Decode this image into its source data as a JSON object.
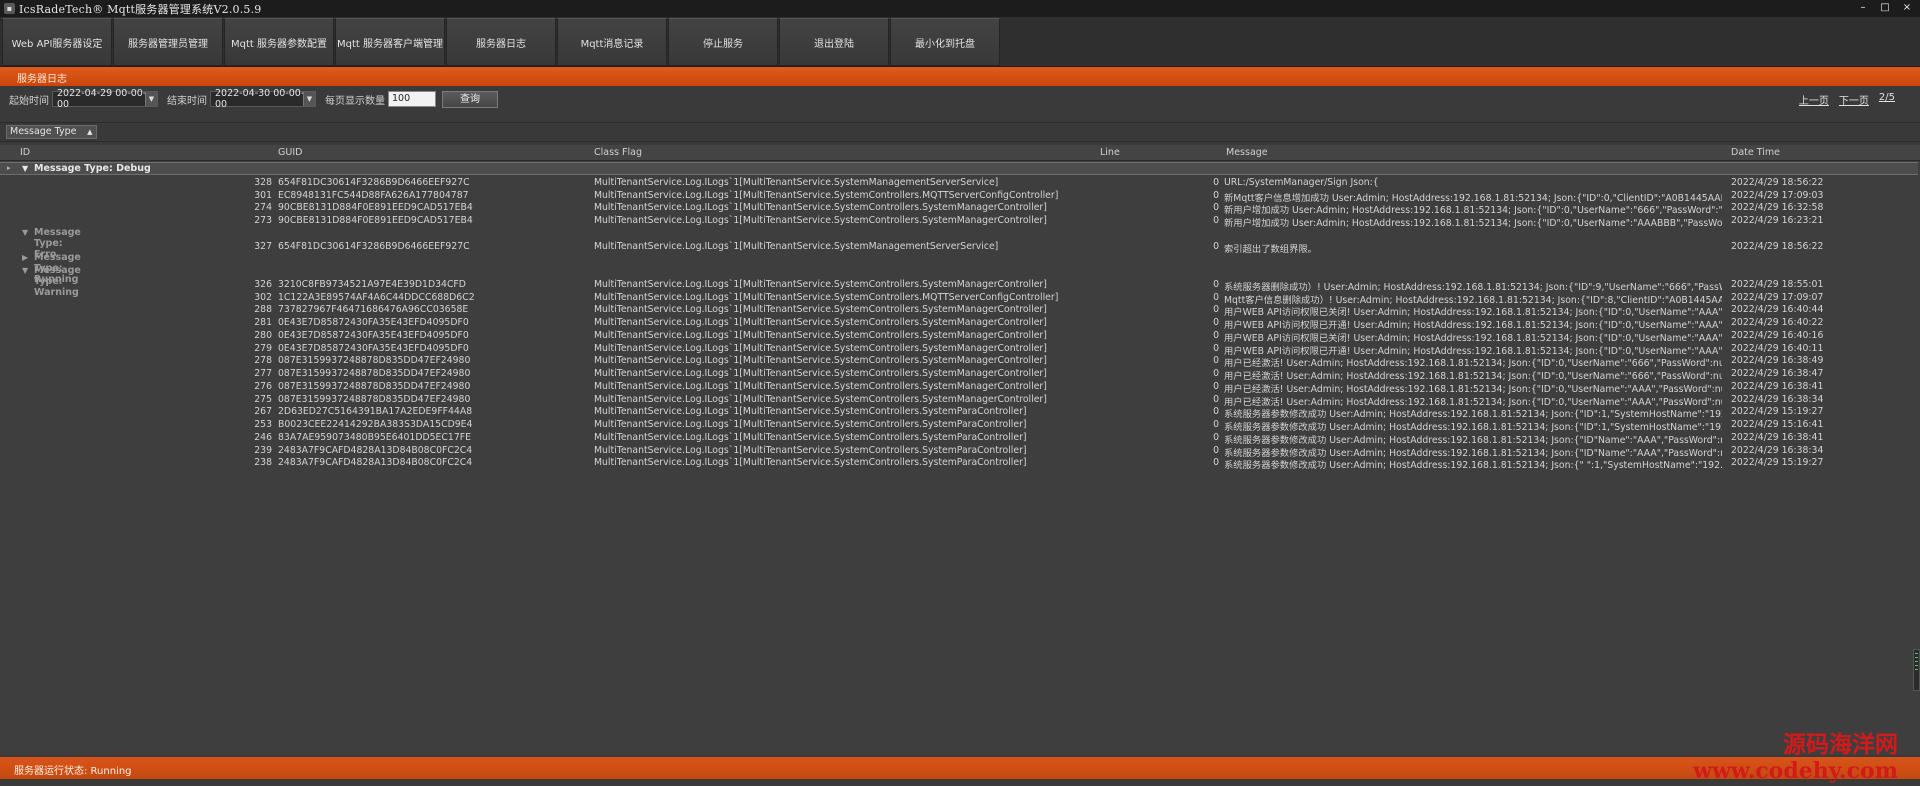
{
  "window": {
    "title": "IcsRadeTech® Mqtt服务器管理系统V2.0.5.9",
    "controls": [
      "–",
      "□",
      "×"
    ]
  },
  "menu": [
    "Web API服务器设定",
    "服务器管理员管理",
    "Mqtt 服务器参数配置",
    "Mqtt 服务器客户端管理",
    "服务器日志",
    "Mqtt消息记录",
    "停止服务",
    "退出登陆",
    "最小化到托盘"
  ],
  "section_title": "服务器日志",
  "filter": {
    "start_label": "起始时间",
    "start_value": "2022-04-29 00-00-00",
    "end_label": "结束时间",
    "end_value": "2022-04-30 00-00-00",
    "count_label": "每页显示数量",
    "count_value": "100",
    "query_button": "查询"
  },
  "pager": {
    "prev": "上一页",
    "next": "下一页",
    "page": "2/5"
  },
  "group_chip": "Message Type",
  "columns": {
    "id": "ID",
    "guid": "GUID",
    "class_flag": "Class Flag",
    "line": "Line",
    "message": "Message",
    "date_time": "Date Time"
  },
  "groups": [
    {
      "label": "Message Type: Debug",
      "rows": [
        {
          "id": "328",
          "guid": "654F81DC30614F3286B9D6466EEF927C",
          "class": "MultiTenantService.Log.ILogs`1[MultiTenantService.SystemManagementServerService]",
          "line": "0",
          "message": "URL:/SystemManager/Sign Json:{",
          "date": "2022/4/29 18:56:22"
        },
        {
          "id": "301",
          "guid": "EC8948131FC544D88FA626A177804787",
          "class": "MultiTenantService.Log.ILogs`1[MultiTenantService.SystemControllers.MQTTServerConfigController]",
          "line": "0",
          "message": "新Mqtt客户信息增加成功 User:Admin;  HostAddress:192.168.1.81:52134;  Json:{\"ID\":0,\"ClientID\":\"A0B1445AADD\",\"Us...",
          "date": "2022/4/29 17:09:03"
        },
        {
          "id": "274",
          "guid": "90CBE8131D884F0E891EED9CAD517EB4",
          "class": "MultiTenantService.Log.ILogs`1[MultiTenantService.SystemControllers.SystemManagerController]",
          "line": "0",
          "message": "新用户增加成功 User:Admin;  HostAddress:192.168.1.81:52134;  Json:{\"ID\":0,\"UserName\":\"666\",\"PassWord\":\"\",\"Key\"...",
          "date": "2022/4/29 16:32:58"
        },
        {
          "id": "273",
          "guid": "90CBE8131D884F0E891EED9CAD517EB4",
          "class": "MultiTenantService.Log.ILogs`1[MultiTenantService.SystemControllers.SystemManagerController]",
          "line": "0",
          "message": "新用户增加成功 User:Admin;  HostAddress:192.168.1.81:52134;  Json:{\"ID\":0,\"UserName\":\"AAABBB\",\"PassWord\":\"123...",
          "date": "2022/4/29 16:23:21"
        }
      ]
    },
    {
      "label": "Message Type: Erro",
      "rows": [
        {
          "id": "327",
          "guid": "654F81DC30614F3286B9D6466EEF927C",
          "class": "MultiTenantService.Log.ILogs`1[MultiTenantService.SystemManagementServerService]",
          "line": "0",
          "message": "索引超出了数组界限。",
          "date": "2022/4/29 18:56:22"
        }
      ]
    },
    {
      "label": "Message Type: Running",
      "rows": []
    },
    {
      "label": "Message Type: Warning",
      "rows": [
        {
          "id": "326",
          "guid": "3210C8FB9734521A97E4E39D1D34CFD",
          "class": "MultiTenantService.Log.ILogs`1[MultiTenantService.SystemControllers.SystemManagerController]",
          "line": "0",
          "message": "系统服务器删除成功）!  User:Admin;  HostAddress:192.168.1.81:52134;  Json:{\"ID\":9,\"UserName\":\"666\",\"PassWord\":n...",
          "date": "2022/4/29 18:55:01"
        },
        {
          "id": "302",
          "guid": "1C122A3E89574AF4A6C44DDCC688D6C2",
          "class": "MultiTenantService.Log.ILogs`1[MultiTenantService.SystemControllers.MQTTServerConfigController]",
          "line": "0",
          "message": "Mqtt客户信息删除成功）!  User:Admin;  HostAddress:192.168.1.81:52134;  Json:{\"ID\":8,\"ClientID\":\"A0B1445AADD\",\"U...",
          "date": "2022/4/29 17:09:07"
        },
        {
          "id": "288",
          "guid": "737827967F46471686476A96CC03658E",
          "class": "MultiTenantService.Log.ILogs`1[MultiTenantService.SystemControllers.SystemManagerController]",
          "line": "0",
          "message": "用户WEB API访问权限已关闭!  User:Admin;  HostAddress:192.168.1.81:52134;  Json:{\"ID\":0,\"UserName\":\"AAA\",\"Pass...",
          "date": "2022/4/29 16:40:44"
        },
        {
          "id": "281",
          "guid": "0E43E7D85872430FA35E43EFD4095DF0",
          "class": "MultiTenantService.Log.ILogs`1[MultiTenantService.SystemControllers.SystemManagerController]",
          "line": "0",
          "message": "用户WEB API访问权限已开通!  User:Admin;  HostAddress:192.168.1.81:52134;  Json:{\"ID\":0,\"UserName\":\"AAA\",\"Pass...",
          "date": "2022/4/29 16:40:22"
        },
        {
          "id": "280",
          "guid": "0E43E7D85872430FA35E43EFD4095DF0",
          "class": "MultiTenantService.Log.ILogs`1[MultiTenantService.SystemControllers.SystemManagerController]",
          "line": "0",
          "message": "用户WEB API访问权限已关闭!  User:Admin;  HostAddress:192.168.1.81:52134;  Json:{\"ID\":0,\"UserName\":\"AAA\",\"Pass...",
          "date": "2022/4/29 16:40:16"
        },
        {
          "id": "279",
          "guid": "0E43E7D85872430FA35E43EFD4095DF0",
          "class": "MultiTenantService.Log.ILogs`1[MultiTenantService.SystemControllers.SystemManagerController]",
          "line": "0",
          "message": "用户WEB API访问权限已开通!  User:Admin;  HostAddress:192.168.1.81:52134;  Json:{\"ID\":0,\"UserName\":\"AAA\",\"Pass...",
          "date": "2022/4/29 16:40:11"
        },
        {
          "id": "278",
          "guid": "087E3159937248878D835DD47EF24980",
          "class": "MultiTenantService.Log.ILogs`1[MultiTenantService.SystemControllers.SystemManagerController]",
          "line": "0",
          "message": "用户已经激活!  User:Admin;  HostAddress:192.168.1.81:52134;  Json:{\"ID\":0,\"UserName\":\"666\",\"PassWord\":null,\"Key\"...",
          "date": "2022/4/29 16:38:49"
        },
        {
          "id": "277",
          "guid": "087E3159937248878D835DD47EF24980",
          "class": "MultiTenantService.Log.ILogs`1[MultiTenantService.SystemControllers.SystemManagerController]",
          "line": "0",
          "message": "用户已经激活!  User:Admin;  HostAddress:192.168.1.81:52134;  Json:{\"ID\":0,\"UserName\":\"666\",\"PassWord\":null,\"Key\"...",
          "date": "2022/4/29 16:38:47"
        },
        {
          "id": "276",
          "guid": "087E3159937248878D835DD47EF24980",
          "class": "MultiTenantService.Log.ILogs`1[MultiTenantService.SystemControllers.SystemManagerController]",
          "line": "0",
          "message": "用户已经激活!  User:Admin;  HostAddress:192.168.1.81:52134;  Json:{\"ID\":0,\"UserName\":\"AAA\",\"PassWord\":null,\"Key...",
          "date": "2022/4/29 16:38:41"
        },
        {
          "id": "275",
          "guid": "087E3159937248878D835DD47EF24980",
          "class": "MultiTenantService.Log.ILogs`1[MultiTenantService.SystemControllers.SystemManagerController]",
          "line": "0",
          "message": "用户已经激活!  User:Admin;  HostAddress:192.168.1.81:52134;  Json:{\"ID\":0,\"UserName\":\"AAA\",\"PassWord\":null,\"Key...",
          "date": "2022/4/29 16:38:34"
        },
        {
          "id": "267",
          "guid": "2D63ED27C5164391BA17A2EDE9FF44A8",
          "class": "MultiTenantService.Log.ILogs`1[MultiTenantService.SystemControllers.SystemParaController]",
          "line": "0",
          "message": "系统服务器参数修改成功 User:Admin;  HostAddress:192.168.1.81:52134;  Json:{\"ID\":1,\"SystemHostName\":\"192.168...",
          "date": "2022/4/29 15:19:27"
        },
        {
          "id": "253",
          "guid": "B0023CEE22414292BA383S3DA15CD9E4",
          "class": "MultiTenantService.Log.ILogs`1[MultiTenantService.SystemControllers.SystemParaController]",
          "line": "0",
          "message": "系统服务器参数修改成功 User:Admin;  HostAddress:192.168.1.81:52134;  Json:{\"ID\":1,\"SystemHostName\":\"192.168.1...",
          "date": "2022/4/29 15:16:41"
        },
        {
          "id": "246",
          "guid": "83A7AE959073480B95E6401DD5EC17FE",
          "class": "MultiTenantService.Log.ILogs`1[MultiTenantService.SystemControllers.SystemParaController]",
          "line": "0",
          "message": "系统服务器参数修改成功 User:Admin;  HostAddress:192.168.1.81:52134;  Json:{\"ID\"Name\":\"AAA\",\"PassWord\":null,\"Key...",
          "date": "2022/4/29 16:38:41"
        },
        {
          "id": "239",
          "guid": "2483A7F9CAFD4828A13D84B08C0FC2C4",
          "class": "MultiTenantService.Log.ILogs`1[MultiTenantService.SystemControllers.SystemParaController]",
          "line": "0",
          "message": "系统服务器参数修改成功 User:Admin;  HostAddress:192.168.1.81:52134;  Json:{\"ID\"Name\":\"AAA\",\"PassWord\":null,\"Key...",
          "date": "2022/4/29 16:38:34"
        },
        {
          "id": "238",
          "guid": "2483A7F9CAFD4828A13D84B08C0FC2C4",
          "class": "MultiTenantService.Log.ILogs`1[MultiTenantService.SystemControllers.SystemParaController]",
          "line": "0",
          "message": "系统服务器参数修改成功 User:Admin;  HostAddress:192.168.1.81:52134;  Json:{\"  \":1,\"SystemHostName\":\"192.168.1...",
          "date": "2022/4/29 15:19:27"
        }
      ]
    }
  ],
  "status": "服务器运行状态: Running",
  "watermark": {
    "line1": "源码海洋网",
    "line2": "www.codehy.com"
  }
}
